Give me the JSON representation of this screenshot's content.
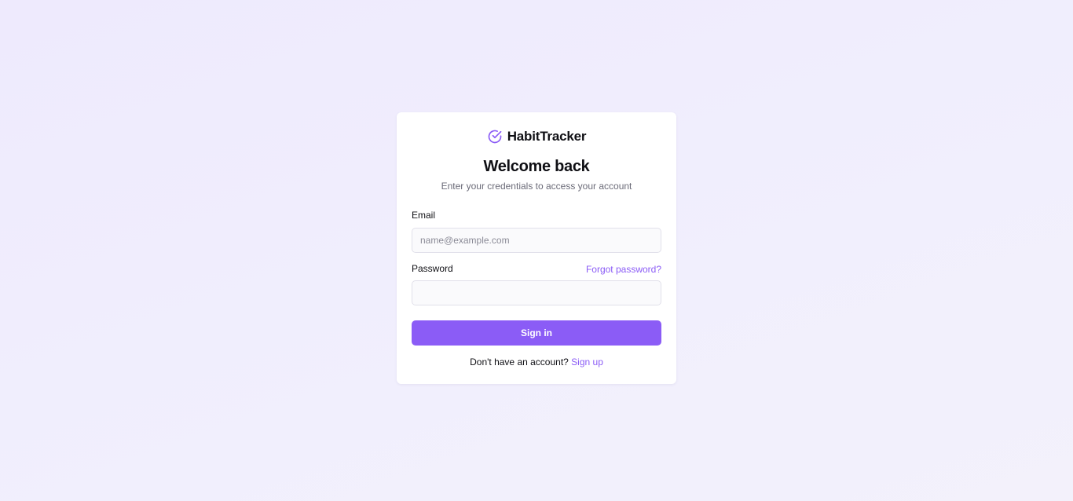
{
  "brand": {
    "name": "HabitTracker",
    "icon": "check-circle-icon",
    "accent_color": "#8b5cf6"
  },
  "heading": {
    "title": "Welcome back",
    "subtitle": "Enter your credentials to access your account"
  },
  "form": {
    "email_label": "Email",
    "email_value": "",
    "email_placeholder": "name@example.com",
    "password_label": "Password",
    "password_value": "",
    "forgot_link": "Forgot password?",
    "submit_label": "Sign in"
  },
  "footer": {
    "prompt": "Don't have an account?",
    "signup_link": "Sign up"
  }
}
